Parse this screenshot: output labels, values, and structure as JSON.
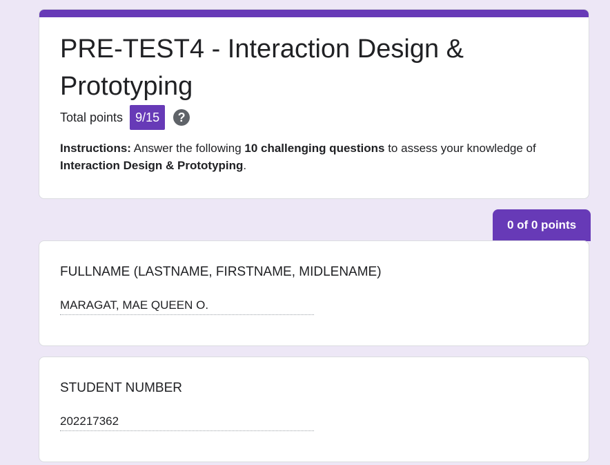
{
  "header": {
    "title": "PRE-TEST4 - Interaction Design & Prototyping",
    "points_label": "Total points",
    "points_value": "9/15",
    "help_icon": "help-circle-icon",
    "instructions": {
      "prefix": "Instructions:",
      "text1": " Answer the following ",
      "bold1": "10 challenging questions",
      "text2": " to assess your knowledge of ",
      "bold2": "Interaction Design & Prototyping",
      "text3": "."
    }
  },
  "section": {
    "score": "0 of 0 points"
  },
  "questions": [
    {
      "title": "FULLNAME (LASTNAME, FIRSTNAME, MIDLENAME)",
      "answer": "MARAGAT, MAE QUEEN O."
    },
    {
      "title": "STUDENT NUMBER",
      "answer": "202217362"
    }
  ],
  "colors": {
    "accent": "#673ab7",
    "background": "#ede7f6"
  }
}
